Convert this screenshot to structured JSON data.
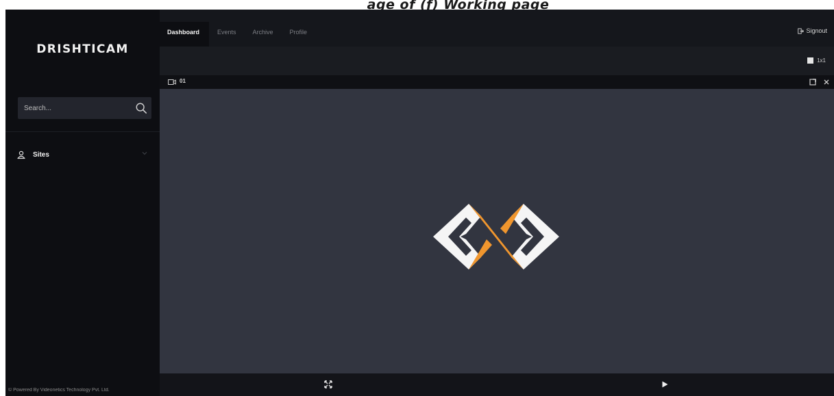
{
  "caption": "age of (ƒ) Working page",
  "app": {
    "brand": "DRISHTICAM",
    "footer": "© Powered By Videonetics Technology Pvt. Ltd."
  },
  "sidebar": {
    "search": {
      "placeholder": "Search...",
      "icon": "search-icon"
    },
    "items": [
      {
        "label": "Sites",
        "icon": "sites-icon",
        "expand_icon": "chevron-down-icon"
      }
    ]
  },
  "header": {
    "tabs": [
      {
        "label": "Dashboard",
        "active": true
      },
      {
        "label": "Events",
        "active": false
      },
      {
        "label": "Archive",
        "active": false
      },
      {
        "label": "Profile",
        "active": false
      }
    ],
    "signout_label": "Signout",
    "layout_label": "1x1"
  },
  "camera": {
    "label": "01",
    "icons": [
      "camera-icon",
      "maximize-icon",
      "close-icon"
    ],
    "logo": "drishticam-logo"
  },
  "controls": {
    "icons": [
      "fullscreen-icon",
      "play-icon"
    ]
  },
  "colors": {
    "accent": "#f0962e",
    "sidebar_bg": "#0d0e12",
    "video_bg": "#323540",
    "topbar_bg": "#15171c"
  }
}
